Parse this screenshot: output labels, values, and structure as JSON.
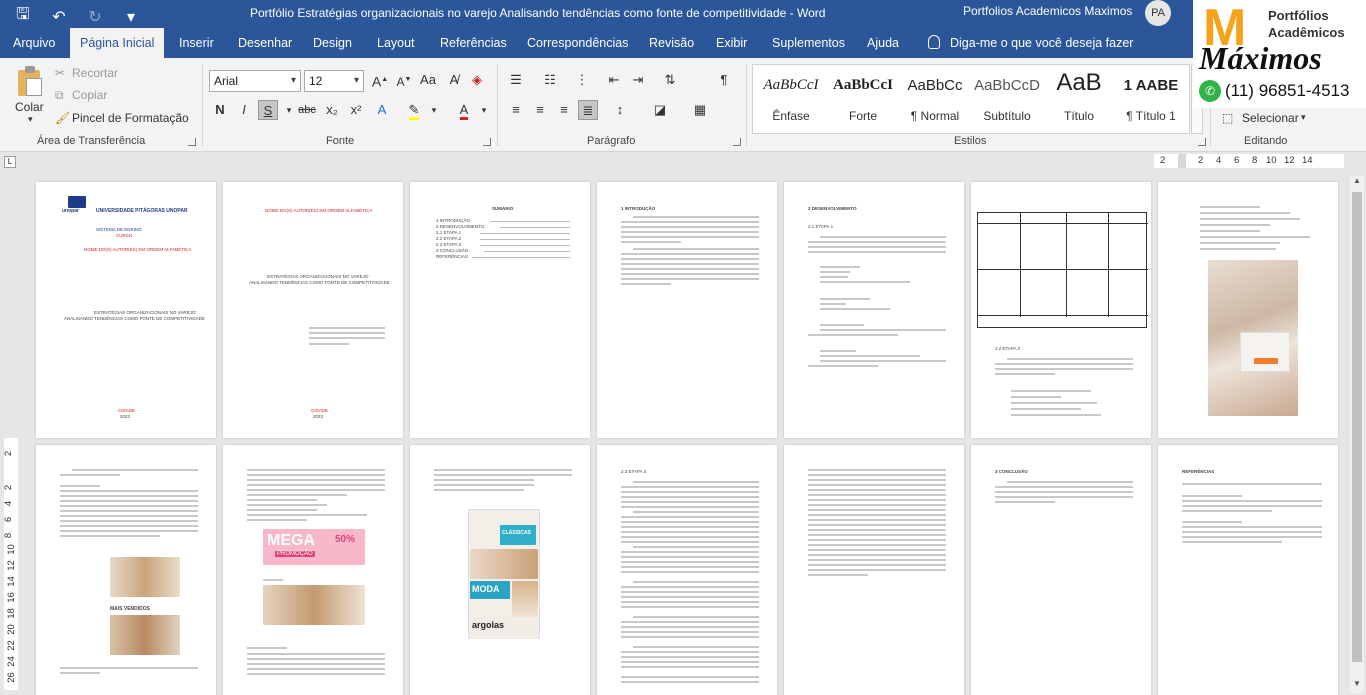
{
  "titlebar": {
    "title": "Portfólio Estratégias organizacionais no varejo Analisando tendências como fonte de competitividade  -  Word",
    "user": "Portfolios Academicos Maximos",
    "avatar_initials": "PA"
  },
  "tabs": [
    "Arquivo",
    "Página Inicial",
    "Inserir",
    "Desenhar",
    "Design",
    "Layout",
    "Referências",
    "Correspondências",
    "Revisão",
    "Exibir",
    "Suplementos",
    "Ajuda"
  ],
  "tell_me": "Diga-me o que você deseja fazer",
  "clipboard": {
    "paste": "Colar",
    "cut": "Recortar",
    "copy": "Copiar",
    "format_painter": "Pincel de Formatação",
    "group": "Área de Transferência"
  },
  "font": {
    "name": "Arial",
    "size": "12",
    "group": "Fonte",
    "bold": "N",
    "italic": "I",
    "underline": "S",
    "strike": "abc",
    "sub": "x₂",
    "sup": "x²"
  },
  "paragraph": {
    "group": "Parágrafo"
  },
  "styles": {
    "group": "Estilos",
    "items": [
      {
        "preview": "AaBbCcI",
        "name": "Ênfase"
      },
      {
        "preview": "AaBbCcI",
        "name": "Forte"
      },
      {
        "preview": "AaBbCc",
        "name": "¶ Normal"
      },
      {
        "preview": "AaBbCcD",
        "name": "Subtítulo"
      },
      {
        "preview": "AaB",
        "name": "Título"
      },
      {
        "preview": "1 AABE",
        "name": "¶ Título 1"
      }
    ]
  },
  "editing": {
    "select": "Selecionar",
    "group": "Editando"
  },
  "logo": {
    "letter": "M",
    "line1": "Portfólios",
    "line2": "Acadêmicos",
    "line3": "Máximos",
    "phone": "(11) 96851-4513"
  },
  "ruler_marks": [
    "2",
    "2",
    "4",
    "6",
    "8",
    "10",
    "12",
    "14"
  ],
  "vruler_marks": [
    "2",
    "2",
    "4",
    "6",
    "8",
    "10",
    "12",
    "14",
    "16",
    "18",
    "20",
    "22",
    "24",
    "26"
  ],
  "pages_text": {
    "cover_university": "UNIVERSIDADE PITÁGORAS UNOPAR",
    "cover_logo": "unopar",
    "cover_system": "SISTEMA DE ENSINO ",
    "cover_course": "CURSO",
    "cover_authors": "NOME DO(S) AUTOR(ES) EM ORDEM ALFABÉTICA",
    "cover_title": "ESTRATÉGIAS ORGANIZACIONAIS NO VAREJO:",
    "cover_subtitle": "ANALISANDO TENDÊNCIAS COMO FONTE DE COMPETITIVIDADE",
    "city": "CIDADE",
    "year": "2023",
    "summary": "SUMÁRIO",
    "summary_items": [
      "1    INTRODUÇÃO",
      "2    DESENVOLVIMENTO",
      "2.1     ETAPA 1",
      "2.2     ETAPA 2",
      "2.3     ETAPA 3",
      "3    CONCLUSÃO",
      "REFERÊNCIAS"
    ],
    "intro": "1 INTRODUÇÃO",
    "dev": "2 DESENVOLVIMENTO",
    "etapa1": "2.1 ETAPA 1",
    "etapa2": "2.2 ETAPA 2",
    "etapa3": "2.3 ETAPA 3",
    "conclusion": "3 CONCLUSÃO",
    "references": "REFERÊNCIAS",
    "mega": "MEGA",
    "promo": "PROMOÇÃO",
    "discount": "50%",
    "classicas": "CLÁSSICAS",
    "moda": "MODA",
    "argolas": "argolas",
    "mais_vendidos": "MAIS VENDIDOS"
  }
}
